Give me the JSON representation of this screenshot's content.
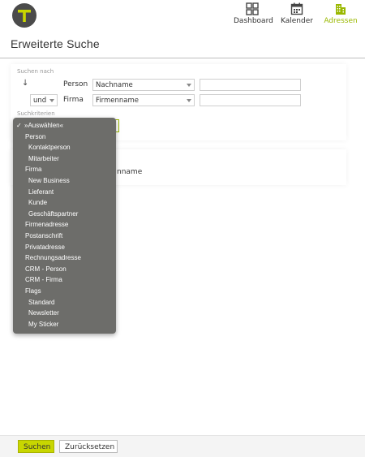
{
  "nav": {
    "dashboard": "Dashboard",
    "kalender": "Kalender",
    "adressen": "Adressen"
  },
  "page": {
    "title": "Erweiterte Suche"
  },
  "search": {
    "suchen_nach_label": "Suchen nach",
    "sort_arrow": "↓",
    "rows": [
      {
        "conj": "",
        "entity": "Person",
        "field": "Nachname",
        "value": ""
      },
      {
        "conj": "und",
        "entity": "Firma",
        "field": "Firmenname",
        "value": ""
      }
    ],
    "suchkriterien_label": "Suchkriterien"
  },
  "panel2": {
    "text": "nname"
  },
  "dropdown": {
    "check_mark": "✓",
    "options": [
      {
        "label": "»Auswählen«",
        "kind": "selected"
      },
      {
        "label": "Person",
        "kind": "group"
      },
      {
        "label": "Kontaktperson",
        "kind": "child"
      },
      {
        "label": "Mitarbeiter",
        "kind": "child"
      },
      {
        "label": "Firma",
        "kind": "group"
      },
      {
        "label": "New Business",
        "kind": "child"
      },
      {
        "label": "Lieferant",
        "kind": "child"
      },
      {
        "label": "Kunde",
        "kind": "child"
      },
      {
        "label": "Geschäftspartner",
        "kind": "child"
      },
      {
        "label": "Firmenadresse",
        "kind": "group"
      },
      {
        "label": "Postanschrift",
        "kind": "group"
      },
      {
        "label": "Privatadresse",
        "kind": "group"
      },
      {
        "label": "Rechnungsadresse",
        "kind": "group"
      },
      {
        "label": "CRM - Person",
        "kind": "group"
      },
      {
        "label": "CRM - Firma",
        "kind": "group"
      },
      {
        "label": "Flags",
        "kind": "group"
      },
      {
        "label": "Standard",
        "kind": "child"
      },
      {
        "label": "Newsletter",
        "kind": "child"
      },
      {
        "label": "My Sticker",
        "kind": "child"
      }
    ]
  },
  "footer": {
    "suchen_label": "Suchen",
    "reset_label": "Zurücksetzen"
  },
  "colors": {
    "accent": "#9ab800",
    "button_primary": "#c8d600",
    "dropdown_bg": "#6d6d6a",
    "logo_bg": "#4b4b4b"
  },
  "icons": {
    "logo": "t-logo-icon",
    "dashboard": "dashboard-grid-icon",
    "kalender": "calendar-icon",
    "adressen": "building-icon"
  }
}
